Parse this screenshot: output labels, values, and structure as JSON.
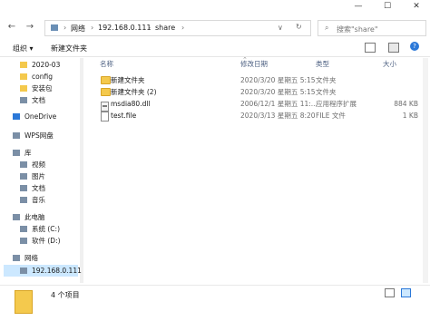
{
  "address": {
    "back_icon": "arrow-left-icon",
    "forward_icon": "arrow-right-icon",
    "crumbs": [
      "网络",
      "192.168.0.111",
      "share"
    ],
    "search_placeholder": "搜索\"share\""
  },
  "toolbar": {
    "organize": "组织",
    "new_folder": "新建文件夹"
  },
  "nav": {
    "items": [
      {
        "label": "2020-03",
        "icon": "folder-icon"
      },
      {
        "label": "config",
        "icon": "folder-icon"
      },
      {
        "label": "安装包",
        "icon": "folder-icon"
      },
      {
        "label": "文档",
        "icon": "document-icon"
      },
      {
        "label": "OneDrive",
        "icon": "cloud-icon"
      },
      {
        "label": "WPS网盘",
        "icon": "wps-cloud-icon"
      },
      {
        "label": "库",
        "icon": "library-icon"
      },
      {
        "label": "视频",
        "icon": "video-icon"
      },
      {
        "label": "图片",
        "icon": "picture-icon"
      },
      {
        "label": "文档",
        "icon": "document-icon"
      },
      {
        "label": "音乐",
        "icon": "music-icon"
      },
      {
        "label": "此电脑",
        "icon": "computer-icon"
      },
      {
        "label": "系统 (C:)",
        "icon": "drive-icon"
      },
      {
        "label": "软件 (D:)",
        "icon": "drive-icon"
      },
      {
        "label": "网络",
        "icon": "network-icon"
      },
      {
        "label": "192.168.0.111",
        "icon": "network-computer-icon"
      }
    ]
  },
  "columns": {
    "name": "名称",
    "modified": "修改日期",
    "type": "类型",
    "size": "大小"
  },
  "files": [
    {
      "name": "新建文件夹",
      "modified": "2020/3/20 星期五 5:15",
      "type": "文件夹",
      "size": "",
      "icon": "folder-icon"
    },
    {
      "name": "新建文件夹 (2)",
      "modified": "2020/3/20 星期五 5:15",
      "type": "文件夹",
      "size": "",
      "icon": "folder-icon"
    },
    {
      "name": "msdia80.dll",
      "modified": "2006/12/1 星期五 11:...",
      "type": "应用程序扩展",
      "size": "884 KB",
      "icon": "dll-file-icon"
    },
    {
      "name": "test.file",
      "modified": "2020/3/13 星期五 8:20",
      "type": "FILE 文件",
      "size": "1 KB",
      "icon": "file-icon"
    }
  ],
  "status": {
    "count": "4 个项目"
  },
  "colors": {
    "selection": "#cce8ff",
    "folder": "#f4c94d",
    "header_text": "#4d6082"
  }
}
